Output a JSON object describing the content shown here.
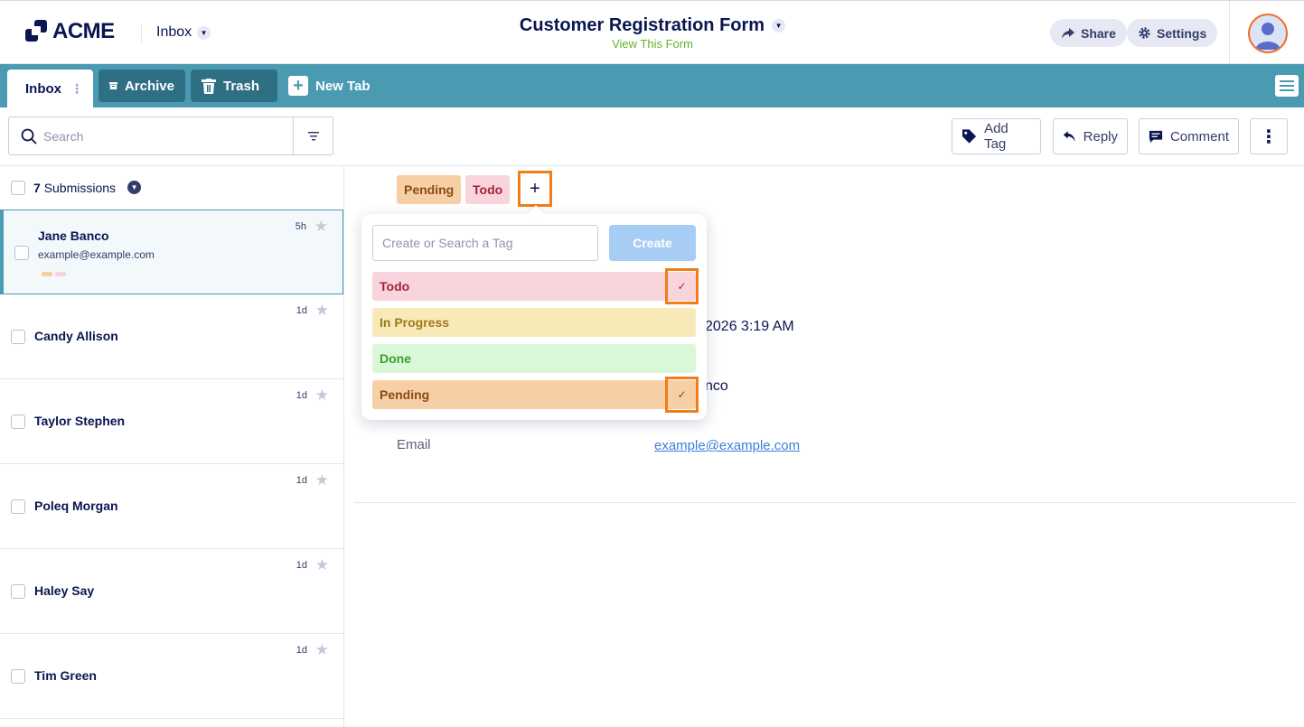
{
  "header": {
    "logo_text": "ACME",
    "inbox_label": "Inbox",
    "form_title": "Customer Registration Form",
    "form_subtitle": "View This Form",
    "share_label": "Share",
    "settings_label": "Settings"
  },
  "tabs": {
    "inbox": "Inbox",
    "archive": "Archive",
    "trash": "Trash",
    "new_tab": "New Tab"
  },
  "toolbar": {
    "search_placeholder": "Search",
    "add_tag": "Add Tag",
    "reply": "Reply",
    "comment": "Comment"
  },
  "list": {
    "count": "7",
    "count_label": "Submissions",
    "rows": [
      {
        "name": "Jane Banco",
        "email": "example@example.com",
        "time": "5h"
      },
      {
        "name": "Candy Allison",
        "time": "1d"
      },
      {
        "name": "Taylor Stephen",
        "time": "1d"
      },
      {
        "name": "Poleq Morgan",
        "time": "1d"
      },
      {
        "name": "Haley Say",
        "time": "1d"
      },
      {
        "name": "Tim Green",
        "time": "1d"
      }
    ]
  },
  "content": {
    "applied_tags": [
      "Pending",
      "Todo"
    ],
    "add_symbol": "+",
    "date_fragment": "2026 3:19 AM",
    "name_fragment": "nco",
    "email_label": "Email",
    "email_value": "example@example.com"
  },
  "tag_popover": {
    "input_placeholder": "Create or Search a Tag",
    "create_label": "Create",
    "options": [
      {
        "label": "Todo",
        "checked": true,
        "bg": "#f8d4dc",
        "fg": "#a8213c"
      },
      {
        "label": "In Progress",
        "checked": false,
        "bg": "#f8eab8",
        "fg": "#a0781c"
      },
      {
        "label": "Done",
        "checked": false,
        "bg": "#daf8d7",
        "fg": "#3aa02b"
      },
      {
        "label": "Pending",
        "checked": true,
        "bg": "#f7cfa6",
        "fg": "#8c4b12"
      }
    ]
  },
  "colors": {
    "tab_bar": "#4a9ab2",
    "highlight": "#f07d17",
    "pending_bg": "#f7cfa6",
    "todo_bg": "#f8d4dc"
  }
}
